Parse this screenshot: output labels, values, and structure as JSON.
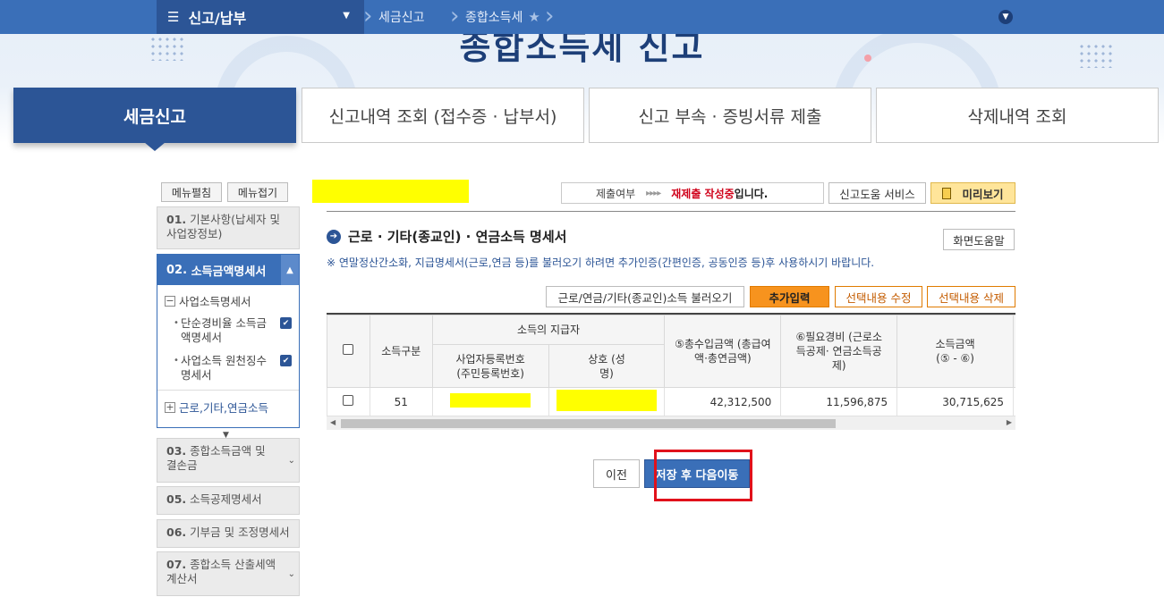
{
  "topbar": {
    "menu_label": "신고/납부",
    "crumbs": [
      "세금신고",
      "종합소득세"
    ]
  },
  "hero": {
    "title": "종합소득세 신고"
  },
  "tabs": [
    {
      "label": "세금신고",
      "active": true
    },
    {
      "label": "신고내역 조회 (접수증 · 납부서)",
      "active": false
    },
    {
      "label": "신고 부속 · 증빙서류 제출",
      "active": false
    },
    {
      "label": "삭제내역 조회",
      "active": false
    }
  ],
  "sidebar": {
    "expand_all": "메뉴펼침",
    "collapse_all": "메뉴접기",
    "item01": {
      "num": "01.",
      "label": "기본사항(납세자 및 사업장정보)"
    },
    "item02": {
      "num": "02.",
      "label": "소득금액명세서"
    },
    "group_business": "사업소득명세서",
    "sub1": "단순경비율 소득금액명세서",
    "sub2": "사업소득 원천징수 명세서",
    "group_wage": "근로,기타,연금소득",
    "item03": {
      "num": "03.",
      "label": "종합소득금액 및 결손금"
    },
    "item05": {
      "num": "05.",
      "label": "소득공제명세서"
    },
    "item06": {
      "num": "06.",
      "label": "기부금 및 조정명세서"
    },
    "item07": {
      "num": "07.",
      "label": "종합소득 산출세액계산서"
    }
  },
  "status": {
    "label": "제출여부",
    "red_text": "재제출 작성중",
    "suffix": "입니다."
  },
  "buttons": {
    "help_service": "신고도움 서비스",
    "preview": "미리보기",
    "screen_help": "화면도움말",
    "load": "근로/연금/기타(종교인)소득 불러오기",
    "add": "추가입력",
    "edit": "선택내용 수정",
    "delete": "선택내용 삭제",
    "prev": "이전",
    "save_next": "저장 후 다음이동"
  },
  "section": {
    "title": "근로 · 기타(종교인) · 연금소득 명세서",
    "notice": "※ 연말정산간소화, 지급명세서(근로,연금 등)를 불러오기 하려면 추가인증(간편인증, 공동인증 등)후 사용하시기 바랍니다."
  },
  "table": {
    "h_type": "소득구분",
    "h_payer": "소득의 지급자",
    "h_regno": "사업자등록번호 (주민등록번호)",
    "h_name": "상호 (성명)",
    "h_total": "⑤총수입금액 (총급여액·총연금액)",
    "h_expense": "⑥필요경비 (근로소득공제· 연금소득공제)",
    "h_income": "소득금액 (⑤ - ⑥)",
    "rows": [
      {
        "type": "51",
        "total": "42,312,500",
        "expense": "11,596,875",
        "income": "30,715,625"
      }
    ]
  }
}
